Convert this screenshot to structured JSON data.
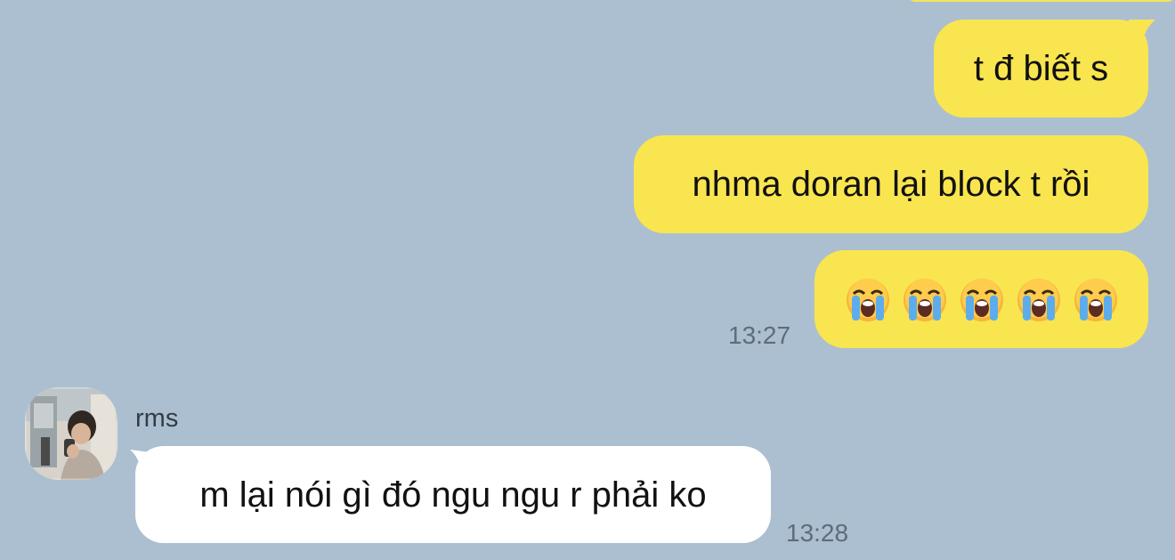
{
  "chat": {
    "outgoing": [
      {
        "text": "t đ biết s"
      },
      {
        "text": "nhma doran lại block t rồi"
      },
      {
        "emoji": "loudly-crying-face-icon",
        "count": 5
      }
    ],
    "outgoing_time": "13:27",
    "incoming": {
      "sender": "rms",
      "text": "m lại nói gì đó ngu ngu r phải ko",
      "time": "13:28"
    }
  },
  "colors": {
    "background": "#acbfd0",
    "outgoing_bubble": "#f9e54f",
    "incoming_bubble": "#ffffff",
    "timestamp": "#5d6c7b"
  }
}
